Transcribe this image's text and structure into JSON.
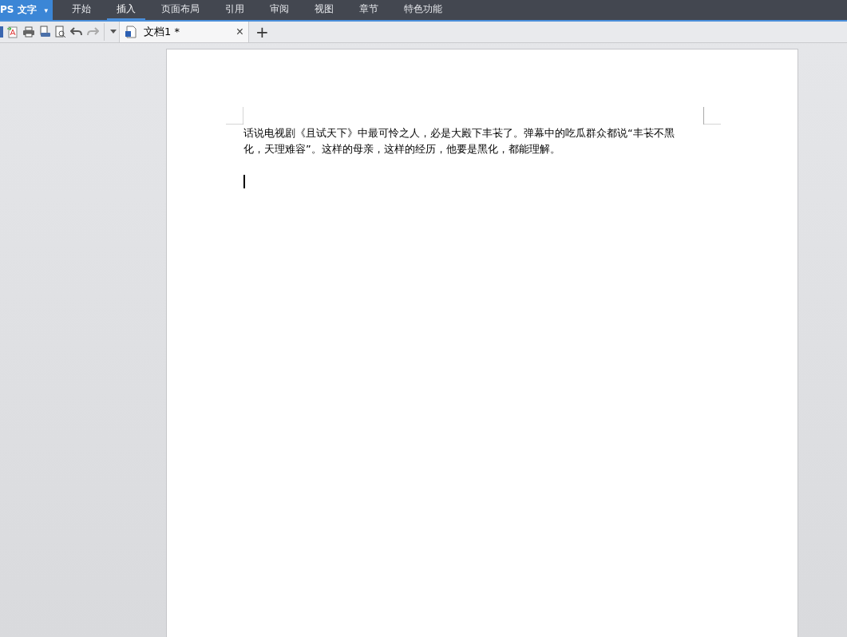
{
  "app_menu": {
    "label": "PS 文字",
    "caret": "▾"
  },
  "ribbon_tabs": [
    {
      "label": "开始",
      "selected": false
    },
    {
      "label": "插入",
      "selected": true
    },
    {
      "label": "页面布局",
      "selected": false
    },
    {
      "label": "引用",
      "selected": false
    },
    {
      "label": "审阅",
      "selected": false
    },
    {
      "label": "视图",
      "selected": false
    },
    {
      "label": "章节",
      "selected": false
    },
    {
      "label": "特色功能",
      "selected": false
    }
  ],
  "document_tabs": [
    {
      "title": "文档1 *",
      "close": "×",
      "selected": true
    }
  ],
  "new_tab": "+",
  "document": {
    "paragraph": "话说电视剧《且试天下》中最可怜之人，必是大殿下丰苌了。弹幕中的吃瓜群众都说“丰苌不黑化，天理难容”。这样的母亲，这样的经历，他要是黑化，都能理解。"
  }
}
